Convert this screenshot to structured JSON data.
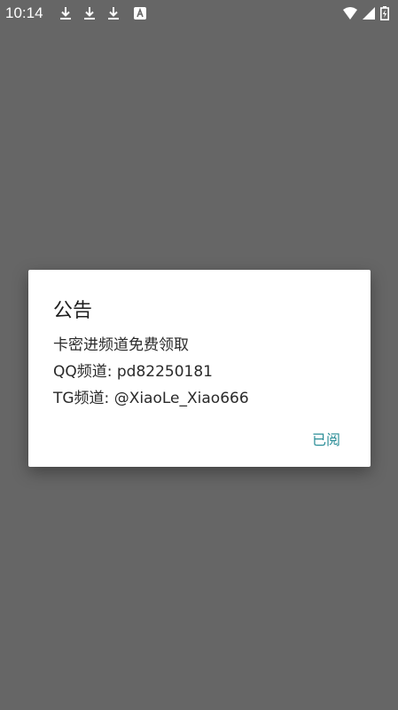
{
  "status_bar": {
    "time": "10:14",
    "notification_icons": [
      "download-icon",
      "download-icon",
      "download-icon",
      "translate-icon"
    ],
    "system_icons": [
      "wifi-icon",
      "signal-icon",
      "battery-icon"
    ]
  },
  "dialog": {
    "title": "公告",
    "lines": [
      "卡密进频道免费领取",
      "QQ频道: pd82250181",
      "TG频道: @XiaoLe_Xiao666"
    ],
    "button_label": "已阅"
  },
  "colors": {
    "scrim": "#666666",
    "accent": "#2a8d97"
  }
}
